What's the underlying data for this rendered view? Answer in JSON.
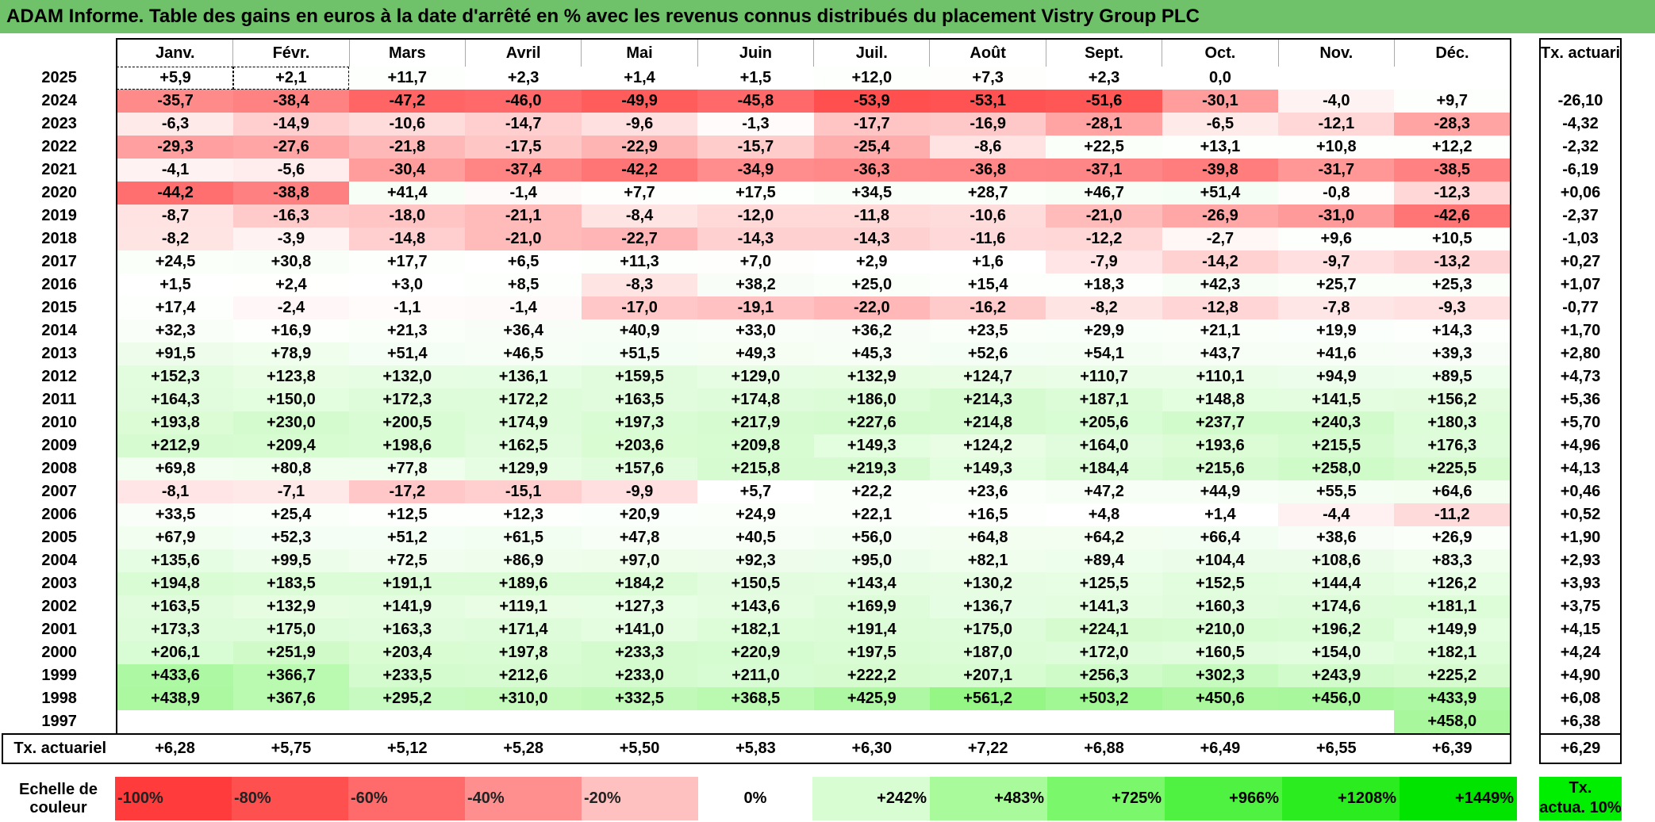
{
  "title": "ADAM Informe. Table des gains en euros à la date d'arrêté en % avec les revenus connus distribués du placement Vistry Group PLC",
  "chart_data": {
    "type": "table",
    "columns": [
      "Janv.",
      "Févr.",
      "Mars",
      "Avril",
      "Mai",
      "Juin",
      "Juil.",
      "Août",
      "Sept.",
      "Oct.",
      "Nov.",
      "Déc."
    ],
    "side_header": "Tx. actuariel",
    "rows": [
      {
        "year": "2025",
        "values": [
          "+5,9",
          "+2,1",
          "+11,7",
          "+2,3",
          "+1,4",
          "+1,5",
          "+12,0",
          "+7,3",
          "+2,3",
          "0,0",
          "",
          ""
        ],
        "rate": ""
      },
      {
        "year": "2024",
        "values": [
          "-35,7",
          "-38,4",
          "-47,2",
          "-46,0",
          "-49,9",
          "-45,8",
          "-53,9",
          "-53,1",
          "-51,6",
          "-30,1",
          "-4,0",
          "+9,7"
        ],
        "rate": "-26,10"
      },
      {
        "year": "2023",
        "values": [
          "-6,3",
          "-14,9",
          "-10,6",
          "-14,7",
          "-9,6",
          "-1,3",
          "-17,7",
          "-16,9",
          "-28,1",
          "-6,5",
          "-12,1",
          "-28,3"
        ],
        "rate": "-4,32"
      },
      {
        "year": "2022",
        "values": [
          "-29,3",
          "-27,6",
          "-21,8",
          "-17,5",
          "-22,9",
          "-15,7",
          "-25,4",
          "-8,6",
          "+22,5",
          "+13,1",
          "+10,8",
          "+12,2"
        ],
        "rate": "-2,32"
      },
      {
        "year": "2021",
        "values": [
          "-4,1",
          "-5,6",
          "-30,4",
          "-37,4",
          "-42,2",
          "-34,9",
          "-36,3",
          "-36,8",
          "-37,1",
          "-39,8",
          "-31,7",
          "-38,5"
        ],
        "rate": "-6,19"
      },
      {
        "year": "2020",
        "values": [
          "-44,2",
          "-38,8",
          "+41,4",
          "-1,4",
          "+7,7",
          "+17,5",
          "+34,5",
          "+28,7",
          "+46,7",
          "+51,4",
          "-0,8",
          "-12,3"
        ],
        "rate": "+0,06"
      },
      {
        "year": "2019",
        "values": [
          "-8,7",
          "-16,3",
          "-18,0",
          "-21,1",
          "-8,4",
          "-12,0",
          "-11,8",
          "-10,6",
          "-21,0",
          "-26,9",
          "-31,0",
          "-42,6"
        ],
        "rate": "-2,37"
      },
      {
        "year": "2018",
        "values": [
          "-8,2",
          "-3,9",
          "-14,8",
          "-21,0",
          "-22,7",
          "-14,3",
          "-14,3",
          "-11,6",
          "-12,2",
          "-2,7",
          "+9,6",
          "+10,5"
        ],
        "rate": "-1,03"
      },
      {
        "year": "2017",
        "values": [
          "+24,5",
          "+30,8",
          "+17,7",
          "+6,5",
          "+11,3",
          "+7,0",
          "+2,9",
          "+1,6",
          "-7,9",
          "-14,2",
          "-9,7",
          "-13,2"
        ],
        "rate": "+0,27"
      },
      {
        "year": "2016",
        "values": [
          "+1,5",
          "+2,4",
          "+3,0",
          "+8,5",
          "-8,3",
          "+38,2",
          "+25,0",
          "+15,4",
          "+18,3",
          "+42,3",
          "+25,7",
          "+25,3"
        ],
        "rate": "+1,07"
      },
      {
        "year": "2015",
        "values": [
          "+17,4",
          "-2,4",
          "-1,1",
          "-1,4",
          "-17,0",
          "-19,1",
          "-22,0",
          "-16,2",
          "-8,2",
          "-12,8",
          "-7,8",
          "-9,3"
        ],
        "rate": "-0,77"
      },
      {
        "year": "2014",
        "values": [
          "+32,3",
          "+16,9",
          "+21,3",
          "+36,4",
          "+40,9",
          "+33,0",
          "+36,2",
          "+23,5",
          "+29,9",
          "+21,1",
          "+19,9",
          "+14,3"
        ],
        "rate": "+1,70"
      },
      {
        "year": "2013",
        "values": [
          "+91,5",
          "+78,9",
          "+51,4",
          "+46,5",
          "+51,5",
          "+49,3",
          "+45,3",
          "+52,6",
          "+54,1",
          "+43,7",
          "+41,6",
          "+39,3"
        ],
        "rate": "+2,80"
      },
      {
        "year": "2012",
        "values": [
          "+152,3",
          "+123,8",
          "+132,0",
          "+136,1",
          "+159,5",
          "+129,0",
          "+132,9",
          "+124,7",
          "+110,7",
          "+110,1",
          "+94,9",
          "+89,5"
        ],
        "rate": "+4,73"
      },
      {
        "year": "2011",
        "values": [
          "+164,3",
          "+150,0",
          "+172,3",
          "+172,2",
          "+163,5",
          "+174,8",
          "+186,0",
          "+214,3",
          "+187,1",
          "+148,8",
          "+141,5",
          "+156,2"
        ],
        "rate": "+5,36"
      },
      {
        "year": "2010",
        "values": [
          "+193,8",
          "+230,0",
          "+200,5",
          "+174,9",
          "+197,3",
          "+217,9",
          "+227,6",
          "+214,8",
          "+205,6",
          "+237,7",
          "+240,3",
          "+180,3"
        ],
        "rate": "+5,70"
      },
      {
        "year": "2009",
        "values": [
          "+212,9",
          "+209,4",
          "+198,6",
          "+162,5",
          "+203,6",
          "+209,8",
          "+149,3",
          "+124,2",
          "+164,0",
          "+193,6",
          "+215,5",
          "+176,3"
        ],
        "rate": "+4,96"
      },
      {
        "year": "2008",
        "values": [
          "+69,8",
          "+80,8",
          "+77,8",
          "+129,9",
          "+157,6",
          "+215,8",
          "+219,3",
          "+149,3",
          "+184,4",
          "+215,6",
          "+258,0",
          "+225,5"
        ],
        "rate": "+4,13"
      },
      {
        "year": "2007",
        "values": [
          "-8,1",
          "-7,1",
          "-17,2",
          "-15,1",
          "-9,9",
          "+5,7",
          "+22,2",
          "+23,6",
          "+47,2",
          "+44,9",
          "+55,5",
          "+64,6"
        ],
        "rate": "+0,46"
      },
      {
        "year": "2006",
        "values": [
          "+33,5",
          "+25,4",
          "+12,5",
          "+12,3",
          "+20,9",
          "+24,9",
          "+22,1",
          "+16,5",
          "+4,8",
          "+1,4",
          "-4,4",
          "-11,2"
        ],
        "rate": "+0,52"
      },
      {
        "year": "2005",
        "values": [
          "+67,9",
          "+52,3",
          "+51,2",
          "+61,5",
          "+47,8",
          "+40,5",
          "+56,0",
          "+64,8",
          "+64,2",
          "+66,4",
          "+38,6",
          "+26,9"
        ],
        "rate": "+1,90"
      },
      {
        "year": "2004",
        "values": [
          "+135,6",
          "+99,5",
          "+72,5",
          "+86,9",
          "+97,0",
          "+92,3",
          "+95,0",
          "+82,1",
          "+89,4",
          "+104,4",
          "+108,6",
          "+83,3"
        ],
        "rate": "+2,93"
      },
      {
        "year": "2003",
        "values": [
          "+194,8",
          "+183,5",
          "+191,1",
          "+189,6",
          "+184,2",
          "+150,5",
          "+143,4",
          "+130,2",
          "+125,5",
          "+152,5",
          "+144,4",
          "+126,2"
        ],
        "rate": "+3,93"
      },
      {
        "year": "2002",
        "values": [
          "+163,5",
          "+132,9",
          "+141,9",
          "+119,1",
          "+127,3",
          "+143,6",
          "+169,9",
          "+136,7",
          "+141,3",
          "+160,3",
          "+174,6",
          "+181,1"
        ],
        "rate": "+3,75"
      },
      {
        "year": "2001",
        "values": [
          "+173,3",
          "+175,0",
          "+163,3",
          "+171,4",
          "+141,0",
          "+182,1",
          "+191,4",
          "+175,0",
          "+224,1",
          "+210,0",
          "+196,2",
          "+149,9"
        ],
        "rate": "+4,15"
      },
      {
        "year": "2000",
        "values": [
          "+206,1",
          "+251,9",
          "+203,4",
          "+197,8",
          "+233,3",
          "+220,9",
          "+197,5",
          "+187,0",
          "+172,0",
          "+160,5",
          "+154,0",
          "+182,1"
        ],
        "rate": "+4,24"
      },
      {
        "year": "1999",
        "values": [
          "+433,6",
          "+366,7",
          "+233,5",
          "+212,6",
          "+233,0",
          "+211,0",
          "+222,2",
          "+207,1",
          "+256,3",
          "+302,3",
          "+243,9",
          "+225,2"
        ],
        "rate": "+4,90"
      },
      {
        "year": "1998",
        "values": [
          "+438,9",
          "+367,6",
          "+295,2",
          "+310,0",
          "+332,5",
          "+368,5",
          "+425,9",
          "+561,2",
          "+503,2",
          "+450,6",
          "+456,0",
          "+433,9"
        ],
        "rate": "+6,08"
      },
      {
        "year": "1997",
        "values": [
          "",
          "",
          "",
          "",
          "",
          "",
          "",
          "",
          "",
          "",
          "",
          "+458,0"
        ],
        "rate": "+6,38"
      }
    ],
    "summary": {
      "label": "Tx. actuariel",
      "values": [
        "+6,28",
        "+5,75",
        "+5,12",
        "+5,28",
        "+5,50",
        "+5,83",
        "+6,30",
        "+7,22",
        "+6,88",
        "+6,49",
        "+6,55",
        "+6,39"
      ],
      "rate": "+6,29"
    },
    "scale": {
      "label_line1": "Echelle de",
      "label_line2": "couleur",
      "steps": [
        {
          "label": "-100%",
          "color": "#ff3b3b",
          "kind": "neg"
        },
        {
          "label": "-80%",
          "color": "#ff5050",
          "kind": "neg"
        },
        {
          "label": "-60%",
          "color": "#ff6a6a",
          "kind": "neg"
        },
        {
          "label": "-40%",
          "color": "#ff8f8f",
          "kind": "neg"
        },
        {
          "label": "-20%",
          "color": "#ffc0c0",
          "kind": "neg"
        },
        {
          "label": "0%",
          "color": "#ffffff",
          "kind": "zero"
        },
        {
          "label": "+242%",
          "color": "#d9fdd2",
          "kind": "pos"
        },
        {
          "label": "+483%",
          "color": "#a9fa9a",
          "kind": "pos"
        },
        {
          "label": "+725%",
          "color": "#7af76a",
          "kind": "pos"
        },
        {
          "label": "+966%",
          "color": "#4ff240",
          "kind": "pos"
        },
        {
          "label": "+1208%",
          "color": "#2bec1f",
          "kind": "pos"
        },
        {
          "label": "+1449%",
          "color": "#00e400",
          "kind": "pos"
        }
      ],
      "side_line1": "Tx.",
      "side_line2": "actua. 10%",
      "side_color": "#00ee00"
    },
    "colors": {
      "title_bg": "#70c26a",
      "negative_max": "#ff3b3b",
      "positive_max": "#8ef57e"
    }
  }
}
